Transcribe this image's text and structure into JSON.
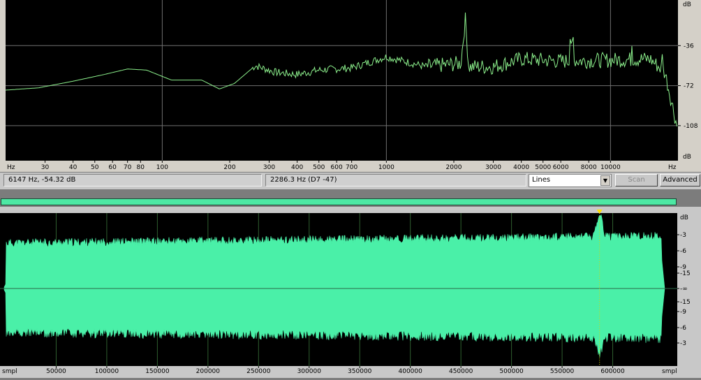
{
  "spectrum": {
    "db_unit": "dB",
    "db_ticks": [
      "-36",
      "-72",
      "-108"
    ],
    "hz_unit_left": "Hz",
    "hz_unit_right": "Hz",
    "hz_ticks": [
      "30",
      "40",
      "50",
      "60",
      "70",
      "80",
      "100",
      "200",
      "300",
      "400",
      "500",
      "600",
      "700",
      "1000",
      "2000",
      "3000",
      "4000",
      "5000",
      "6000",
      "8000",
      "10000"
    ],
    "colors": {
      "trace": "#8cf08c",
      "background": "#000000",
      "grid": "#6a6a6a"
    }
  },
  "status": {
    "cursor_readout": "6147 Hz, -54.32 dB",
    "peak_readout": "2286.3 Hz (D7 -47)",
    "display_mode": "Lines",
    "scan_label": "Scan",
    "advanced_label": "Advanced"
  },
  "progress": {
    "fraction": 1.0,
    "color": "#4de8a4"
  },
  "waveform": {
    "db_unit_top": "dB",
    "db_ticks": [
      "-3",
      "-6",
      "-9",
      "-15",
      "-∞",
      "-15",
      "-9",
      "-6",
      "-3"
    ],
    "x_unit_left": "smpl",
    "x_unit_right": "smpl",
    "x_ticks": [
      "50000",
      "100000",
      "150000",
      "200000",
      "250000",
      "300000",
      "350000",
      "400000",
      "450000",
      "500000",
      "550000",
      "600000"
    ],
    "marker_position": 587000,
    "colors": {
      "wave": "#4af0a8",
      "background": "#000000"
    }
  }
}
